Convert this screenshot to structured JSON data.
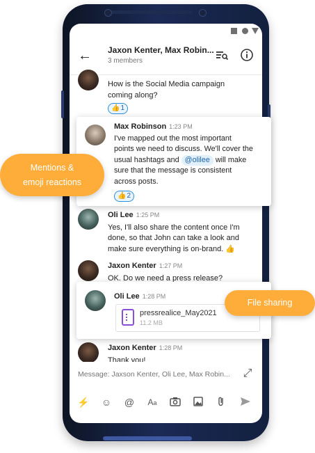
{
  "header": {
    "title": "Jaxon Kenter, Max Robin...",
    "subtitle": "3 members"
  },
  "messages": [
    {
      "text_line1": "How is the Social Media campaign",
      "text_line2": "coming along?",
      "reaction": "1"
    },
    {
      "sender": "Max Robinson",
      "time": "1:23 PM",
      "line1": "I've mapped out the most important",
      "line2": "points we need to discuss. We'll cover the",
      "line3_a": "usual hashtags and",
      "mention": "@olilee",
      "line3_b": "will make",
      "line4": "sure that the message is consistent",
      "line5": "across posts.",
      "reaction": "2"
    },
    {
      "sender": "Oli Lee",
      "time": "1:25 PM",
      "line1": "Yes, I'll also share the content once I'm",
      "line2": "done, so that John can take a look and",
      "line3": "make sure everything is on-brand."
    },
    {
      "sender": "Jaxon Kenter",
      "time": "1:27 PM",
      "line1": "OK. Do we need a press release?"
    },
    {
      "sender": "Oli Lee",
      "time": "1:28 PM",
      "file_name": "pressrealice_May2021",
      "file_size": "11.2 MB"
    },
    {
      "sender": "Jaxon Kenter",
      "time": "1:28 PM",
      "line1": "Thank you!"
    }
  ],
  "composer": {
    "placeholder": "Message: Jaxson Kenter, Oli Lee, Max Robin..."
  },
  "toolbar": [
    "lightning-icon",
    "emoji-icon",
    "at-icon",
    "text-format-icon",
    "camera-icon",
    "image-icon",
    "attachment-icon",
    "send-icon"
  ],
  "callouts": {
    "mentions_line1": "Mentions &",
    "mentions_line2": "emoji reactions",
    "file_sharing": "File sharing"
  },
  "colors": {
    "accent": "#ffad3a",
    "link": "#1a63a8",
    "phone": "#1b2a55"
  }
}
